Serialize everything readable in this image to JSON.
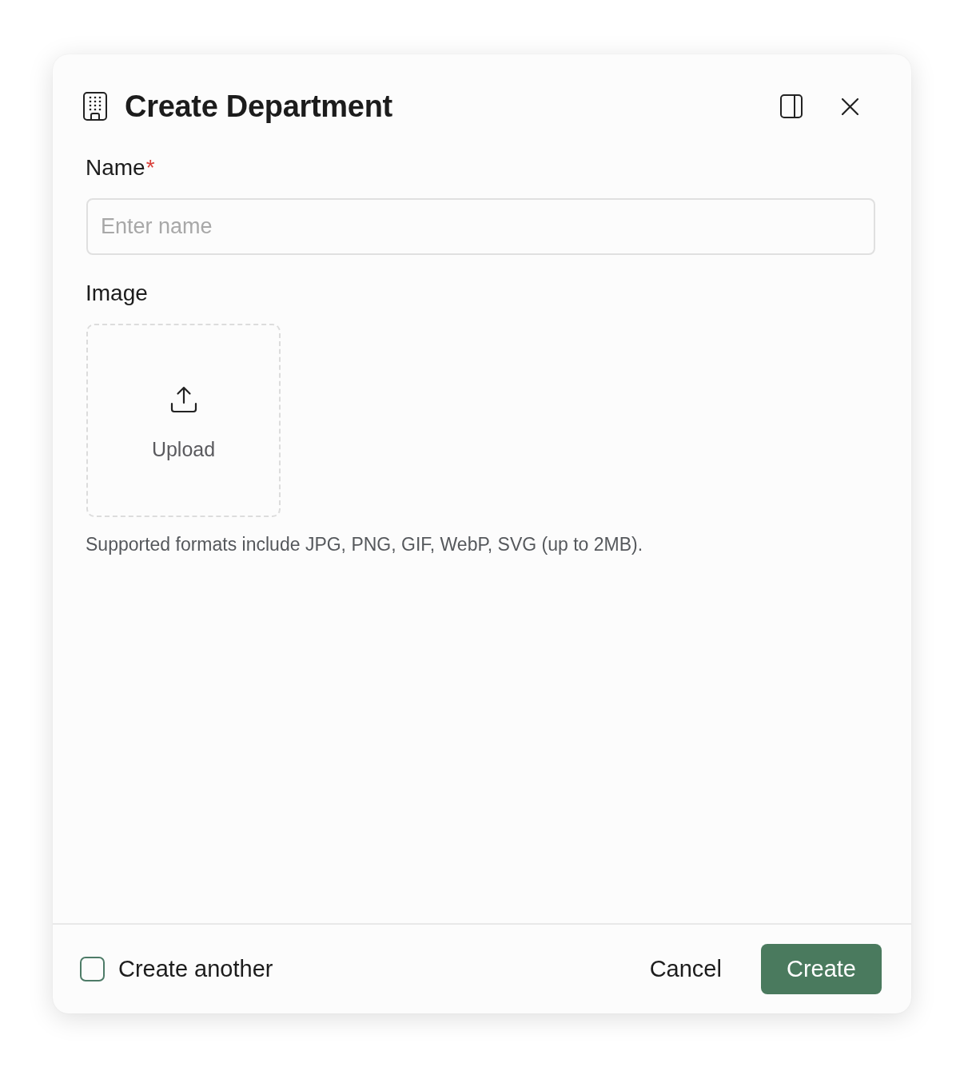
{
  "dialog": {
    "title": "Create Department",
    "fields": [
      {
        "kind": "text",
        "label": "Name",
        "required_mark": "*",
        "placeholder": "Enter name"
      },
      {
        "kind": "image",
        "label": "Image",
        "upload_label": "Upload",
        "help": "Supported formats include JPG, PNG, GIF, WebP, SVG (up to 2MB)."
      }
    ]
  },
  "footer": {
    "create_another": {
      "label": "Create another",
      "checked": false
    },
    "buttons": [
      {
        "kind": "secondary",
        "label": "Cancel"
      },
      {
        "kind": "primary",
        "label": "Create"
      }
    ]
  }
}
